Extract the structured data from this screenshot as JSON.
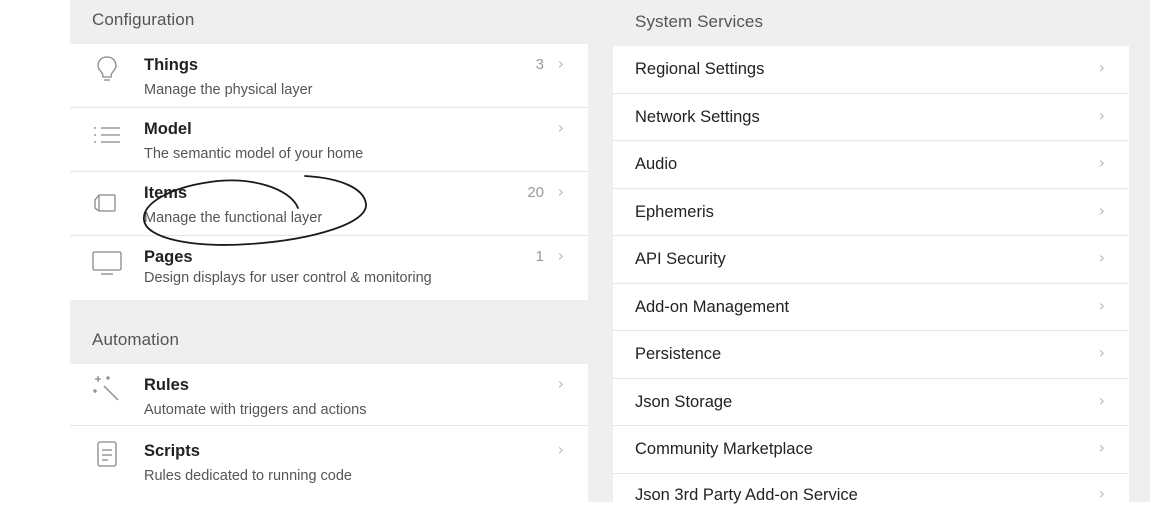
{
  "configuration": {
    "heading": "Configuration",
    "items": [
      {
        "icon": "lightbulb-icon",
        "title": "Things",
        "subtitle": "Manage the physical layer",
        "count": "3"
      },
      {
        "icon": "list-icon",
        "title": "Model",
        "subtitle": "The semantic model of your home",
        "count": ""
      },
      {
        "icon": "cube-icon",
        "title": "Items",
        "subtitle": "Manage the functional layer",
        "count": "20"
      },
      {
        "icon": "monitor-icon",
        "title": "Pages",
        "subtitle": "Design displays for user control & monitoring",
        "count": "1"
      }
    ]
  },
  "automation": {
    "heading": "Automation",
    "items": [
      {
        "icon": "magic-wand-icon",
        "title": "Rules",
        "subtitle": "Automate with triggers and actions",
        "count": ""
      },
      {
        "icon": "script-document-icon",
        "title": "Scripts",
        "subtitle": "Rules dedicated to running code",
        "count": ""
      }
    ]
  },
  "system_services": {
    "heading": "System Services",
    "items": [
      "Regional Settings",
      "Network Settings",
      "Audio",
      "Ephemeris",
      "API Security",
      "Add-on Management",
      "Persistence",
      "Json Storage",
      "Community Marketplace",
      "Json 3rd Party Add-on Service"
    ]
  },
  "chevron": "›",
  "colors": {
    "background": "#efefef",
    "card": "#ffffff",
    "annotation_stroke": "#1a1a1a"
  }
}
